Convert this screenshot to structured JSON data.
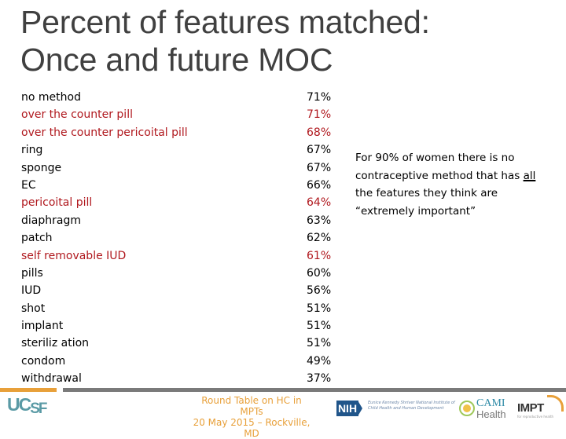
{
  "title": {
    "line1": "Percent of features matched:",
    "line2": "Once and future MOC"
  },
  "colors": {
    "highlight": "#b0181e",
    "text": "#000000",
    "title": "#404040",
    "accent_orange": "#e8a03a",
    "bar_gray": "#7a7a7a",
    "ucsf_teal": "#5a9aa5"
  },
  "methods": [
    {
      "label": "no method",
      "pct": "71%",
      "highlight": false
    },
    {
      "label": "over the counter pill",
      "pct": "71%",
      "highlight": true
    },
    {
      "label": "over the counter pericoital pill",
      "pct": "68%",
      "highlight": true
    },
    {
      "label": "ring",
      "pct": "67%",
      "highlight": false
    },
    {
      "label": "sponge",
      "pct": "67%",
      "highlight": false
    },
    {
      "label": "EC",
      "pct": "66%",
      "highlight": false
    },
    {
      "label": "pericoital pill",
      "pct": "64%",
      "highlight": true
    },
    {
      "label": "diaphragm",
      "pct": "63%",
      "highlight": false
    },
    {
      "label": "patch",
      "pct": "62%",
      "highlight": false
    },
    {
      "label": "self removable IUD",
      "pct": "61%",
      "highlight": true
    },
    {
      "label": "pills",
      "pct": "60%",
      "highlight": false
    },
    {
      "label": "IUD",
      "pct": "56%",
      "highlight": false
    },
    {
      "label": "shot",
      "pct": "51%",
      "highlight": false
    },
    {
      "label": "implant",
      "pct": "51%",
      "highlight": false
    },
    {
      "label": "steriliz ation",
      "pct": "51%",
      "highlight": false
    },
    {
      "label": "condom",
      "pct": "49%",
      "highlight": false
    },
    {
      "label": "withdrawal",
      "pct": "37%",
      "highlight": false
    }
  ],
  "callout": {
    "part1": "For 90% of women there is no contraceptive method that has ",
    "underlined": "all",
    "part2": " the features they think are “extremely important”"
  },
  "footer": {
    "line1": "Round Table on HC in MPTs",
    "line2": "20 May 2015 – Rockville, MD",
    "logos": {
      "ucsf": {
        "uc": "UC",
        "sf": "SF"
      },
      "nih": {
        "mark": "NIH",
        "text": "Eunice Kennedy Shriver National Institute of Child Health and Human Development"
      },
      "cami": {
        "line1": "CAMI",
        "line2": "Health"
      },
      "impt": {
        "mark": "IMPT",
        "tagline": "for reproductive health"
      }
    }
  }
}
